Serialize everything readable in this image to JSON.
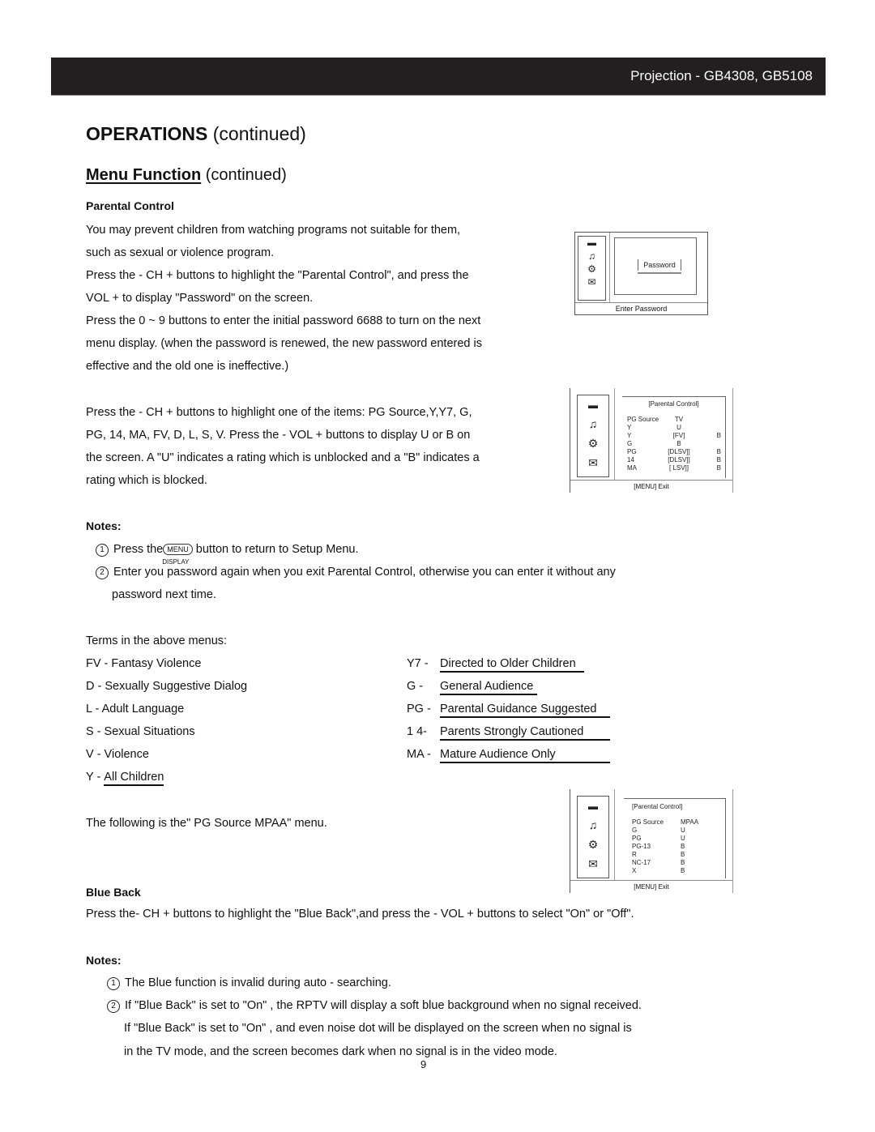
{
  "header": {
    "title": "Projection - GB4308, GB5108"
  },
  "heading": {
    "main_bold": "OPERATIONS",
    "main_rest": "(continued)"
  },
  "subheading": {
    "bold": "Menu Function",
    "rest": "(continued)"
  },
  "parental_control": {
    "title": "Parental Control",
    "paragraphs": [
      "You may prevent children from watching programs not suitable for them,",
      "such as sexual or violence program.",
      "Press the - CH + buttons to highlight the \"Parental Control\", and  press the",
      "VOL + to display \"Password\" on the screen.",
      "Press the 0 ~ 9 buttons to enter the initial password 6688 to turn on the next",
      "menu display. (when the password is renewed, the new password entered is",
      "effective and the old one is ineffective.)"
    ],
    "paragraphs2": [
      "Press the - CH + buttons to highlight one of the items: PG Source,Y,Y7, G,",
      "PG, 14, MA, FV, D, L, S, V.  Press  the  -  VOL + buttons to display U or B on",
      "the screen. A \"U\" indicates a rating which is unblocked and a \"B\" indicates a",
      "rating which is blocked."
    ]
  },
  "screen_password": {
    "box_label": "Password",
    "footer": "Enter  Password"
  },
  "screen_tv": {
    "title": "[Parental Control]",
    "rows": [
      {
        "label": "PG Source",
        "value": "TV",
        "status": ""
      },
      {
        "label": "Y",
        "value": "U",
        "status": ""
      },
      {
        "label": "Y",
        "value": "[FV]",
        "status": "B"
      },
      {
        "label": "G",
        "value": "B",
        "status": ""
      },
      {
        "label": "PG",
        "value": "[DLSV]]",
        "status": "B"
      },
      {
        "label": "14",
        "value": "[DLSV]]",
        "status": "B"
      },
      {
        "label": "MA",
        "value": "[  LSV]]",
        "status": "B"
      }
    ],
    "footer": "[MENU] Exit"
  },
  "notes1": {
    "label": "Notes:",
    "items": [
      {
        "num": "1",
        "before": "Press the",
        "button": "MENU",
        "button_sub": "DISPLAY",
        "after": "button to return to Setup Menu."
      },
      {
        "num": "2",
        "text": "Enter you password again when you exit Parental Control, otherwise you can enter it without any",
        "cont": "password next time."
      }
    ]
  },
  "terms": {
    "intro": "Terms in the above menus:",
    "left": [
      "FV - Fantasy Violence",
      "D - Sexually Suggestive Dialog",
      "L - Adult Language",
      "S  - Sexual Situations",
      "V - Violence"
    ],
    "y_prefix": "Y - ",
    "y_def": "All Children",
    "right": [
      {
        "code": "Y7 -",
        "def": "Directed to Older Children"
      },
      {
        "code": "G -",
        "def": "General Audience"
      },
      {
        "code": "PG -",
        "def": "Parental Guidance Suggested"
      },
      {
        "code": "1 4-",
        "def": "Parents Strongly Cautioned"
      },
      {
        "code": "MA -",
        "def": "Mature Audience Only"
      }
    ]
  },
  "mpaa_intro": "The following is the\" PG Source MPAA\" menu.",
  "screen_mpaa": {
    "title": "[Parental Control]",
    "rows": [
      {
        "label": "PG Source",
        "value": "MPAA"
      },
      {
        "label": "G",
        "value": "U"
      },
      {
        "label": "PG",
        "value": "U"
      },
      {
        "label": "PG-13",
        "value": "B"
      },
      {
        "label": "R",
        "value": "B"
      },
      {
        "label": "NC-17",
        "value": "B"
      },
      {
        "label": "X",
        "value": "B"
      }
    ],
    "footer": "[MENU] Exit"
  },
  "blue_back": {
    "title": "Blue Back",
    "text": "Press the- CH + buttons to highlight the \"Blue Back\",and press the -  VOL + buttons to select \"On\" or \"Off\"."
  },
  "notes2": {
    "label": "Notes:",
    "items": [
      {
        "num": "1",
        "text": "The Blue function is invalid during auto - searching."
      },
      {
        "num": "2",
        "text": "If \"Blue Back\" is set to \"On\" , the RPTV will display a soft blue background when no signal received."
      }
    ],
    "cont": [
      "If \"Blue Back\" is set to \"On\" , and even noise dot will be displayed on the screen when no signal is",
      "in the TV mode, and the screen becomes dark when no signal is in the video mode."
    ]
  },
  "page_number": "9",
  "icons": [
    "picture-icon",
    "sound-icon",
    "setup-icon",
    "function-icon"
  ]
}
